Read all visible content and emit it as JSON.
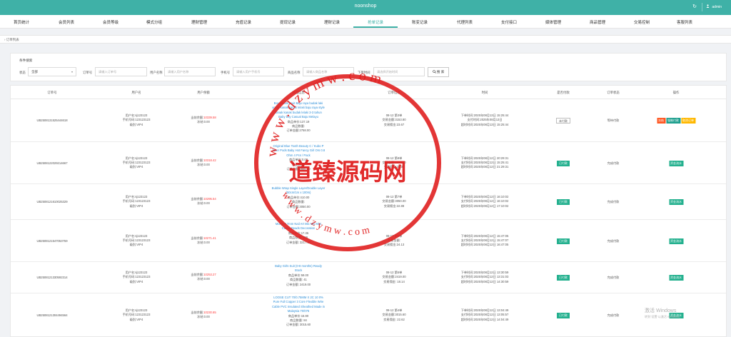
{
  "topbar": {
    "title": "noonshop",
    "refresh_icon": "↻",
    "user_icon": "person-icon",
    "username": "admin"
  },
  "nav": [
    "首页统计",
    "会员列表",
    "会员等级",
    "模式分组",
    "理财管理",
    "充值记录",
    "提现记录",
    "理财记录",
    "抢单记录",
    "账变记录",
    "代理列表",
    "支付接口",
    "媒体管理",
    "商品管理",
    "交易控制",
    "客服列表"
  ],
  "nav_active_index": 8,
  "breadcrumb": "订单列表",
  "filter": {
    "title": "条件搜索",
    "status_label": "状态",
    "status_value": "全部",
    "order_label": "订单号",
    "order_placeholder": "请输入订单号",
    "user_label": "用户名称",
    "user_placeholder": "请输入用户名称",
    "phone_label": "手机号",
    "phone_placeholder": "请输入用户手机号",
    "goods_label": "商品名称",
    "goods_placeholder": "请输入商品名称",
    "time_label": "下单时间",
    "time_placeholder": "请选择开始时间",
    "search_button": "搜 索"
  },
  "table": {
    "headers": [
      "订单号",
      "用户名",
      "用户余额",
      "商品信息",
      "订单信息",
      "时间",
      "是否付款",
      "订单状态",
      "操作"
    ],
    "rows": [
      {
        "order_id": "UB2508131525444618",
        "user": [
          "用户名:sj123123",
          "手机号码:123123123",
          "级别:VIP4"
        ],
        "balance_label": "当前余额:",
        "balance_value": "10339.58",
        "frozen": "冻结:0.00",
        "goods": "Boy fashion suit Baju raya budak laki untuk kanak kanak lelaki baju raya style kanak kanak budak lelaki 3-3 tahun Baby boy Casual Baju Melayu",
        "goods_price": "商品单价:137.19",
        "goods_qty": "商品数量:",
        "goods_total": "订单金额:2758.00",
        "order_info": [
          "08-12 第3单",
          "交易金额:3153.80",
          "交易佣金:23.67"
        ],
        "time": [
          "下单时间:2025年08月13日 15:25:44",
          "支付时间:2025年08月13日",
          "超时时间:2025年08月13日 15:25:44"
        ],
        "pay": "未付款",
        "pay_type": "wait",
        "status": "等待付款",
        "ops": [
          {
            "label": "冻结",
            "color": "red"
          },
          {
            "label": "强制付款",
            "color": "teal"
          },
          {
            "label": "取消订单",
            "color": "yellow"
          }
        ]
      },
      {
        "order_id": "UB2508122029214667",
        "user": [
          "用户名:sj123123",
          "手机号码:123123123",
          "级别:VIP4"
        ],
        "balance_label": "当前余额:",
        "balance_value": "10318.42",
        "frozen": "冻结:0.00",
        "goods": "Original Blue Tooth Beauty C / Kubo P Joker Pods Baby Hot Fancy Girl Ors 0.8 Ohm 4 Pcs / Pack",
        "goods_price": "商品单价:0.00",
        "goods_qty": "商品数量:",
        "goods_total": "订单金额:2850.00",
        "order_info": [
          "08-12 第8单",
          "交易金额:2850.00",
          "交易佣金:21.32"
        ],
        "time": [
          "下单时间:2025年08月12日 20:29:31",
          "支付时间:2025年08月12日 15:25:41",
          "超时时间:2025年08月12日 21:29:31"
        ],
        "pay": "已付款",
        "pay_type": "paid",
        "status": "完成付款",
        "ops": [
          {
            "label": "资金流水",
            "color": "green"
          }
        ]
      },
      {
        "order_id": "UB2508121610025329",
        "user": [
          "用户名:sj123123",
          "手机号码:123123123",
          "级别:VIP4"
        ],
        "balance_label": "当前余额:",
        "balance_value": "10295.54",
        "frozen": "冻结:0.00",
        "goods": "Bubble Wrap Single Layer/Double Layer (50cm/1m x 100m)",
        "goods_price": "商品单价:410.00",
        "goods_qty": "商品数量:",
        "goods_total": "订单金额:3050.00",
        "order_info": [
          "08-12 第7单",
          "交易金额:3050.00",
          "交易佣金:22.88"
        ],
        "time": [
          "下单时间:2025年08月12日 16:10:02",
          "支付时间:2025年08月12日 16:10:02",
          "超时时间:2025年08月12日 17:10:02"
        ],
        "pay": "已付款",
        "pay_type": "paid",
        "status": "完成付款",
        "ops": [
          {
            "label": "资金流水",
            "color": "green"
          }
        ]
      },
      {
        "order_id": "UB2508121547053759",
        "user": [
          "用户名:sj123123",
          "手机号码:123123123",
          "级别:VIP4"
        ],
        "balance_label": "当前余额:",
        "balance_value": "10271.41",
        "frozen": "冻结:0.00",
        "goods": "Manjo 0.7mm Nail Art Mix Mix Mini Caviar Beads Decoration",
        "goods_price": "商品单价:17.35",
        "goods_qty": "商品数量: 186",
        "goods_total": "订单金额: 3217.80",
        "order_info": [
          "08-12 第6单",
          "交易金额:",
          "交易佣金:24.13"
        ],
        "time": [
          "下单时间:2025年08月12日 15:47:05",
          "支付时间:2025年08月12日 15:47:07",
          "超时时间:2025年08月12日 16:47:05"
        ],
        "pay": "已付款",
        "pay_type": "paid",
        "status": "完成付款",
        "ops": [
          {
            "label": "资金流水",
            "color": "green"
          }
        ]
      },
      {
        "order_id": "UB2508121330592314",
        "user": [
          "用户名:sj123123",
          "手机号码:123123123",
          "级别:VIP4"
        ],
        "balance_label": "当前余额:",
        "balance_value": "10253.27",
        "frozen": "冻结:0.00",
        "goods": "Baby Girls Suit (0-8 months) Ready Stock",
        "goods_price": "商品单价:59.00",
        "goods_qty": "商品数量: 41",
        "goods_total": "订单金额: 2419.00",
        "order_info": [
          "08-12 第5单",
          "交易金额:2419.00",
          "交易佣金: 18.14"
        ],
        "time": [
          "下单时间:2025年08月12日 13:30:59",
          "支付时间:2025年08月12日 13:31:03",
          "超时时间:2025年08月12日 14:30:59"
        ],
        "pay": "已付款",
        "pay_type": "paid",
        "status": "完成付款",
        "ops": [
          {
            "label": "资金流水",
            "color": "green"
          }
        ]
      },
      {
        "order_id": "UB2508121304494564",
        "user": [
          "用户名:sj123123",
          "手机号码:123123123",
          "级别:VIP4"
        ],
        "balance_label": "当前余额:",
        "balance_value": "10230.65",
        "frozen": "冻结:0.00",
        "goods": "LOOSE CUT 70/0.75MM X 2C 10 0% Pure Full Copper 3 Core Flexible Wire Cable PVC Insulated Sheathed Made in Malaysia 70/076",
        "goods_price": "商品单价:15.90",
        "goods_qty": "商品数量: 84",
        "goods_total": "订单金额: 3015.60",
        "order_info": [
          "08-12 第4单",
          "交易金额:3015.60",
          "交易佣金: 22.62"
        ],
        "time": [
          "下单时间:2025年08月12日 13:04:49",
          "支付时间:2025年08月12日 13:05:57",
          "超时时间:2025年08月12日 14:04:49"
        ],
        "pay": "已付款",
        "pay_type": "paid",
        "status": "完成付款",
        "ops": [
          {
            "label": "资金流水",
            "color": "green"
          }
        ]
      }
    ]
  },
  "watermark": {
    "text_main": "道臻源码网",
    "text_top": "w w w . d z y m w . c o m",
    "text_bottom": "w w w . d z y m w . c o m",
    "color": "#e02020"
  },
  "windows_activation": {
    "line1": "激活 Windows",
    "line2": "转到\"设置\"以激活 Windows。"
  },
  "colors": {
    "accent": "#3fb1a7",
    "red": "#ff3b3b",
    "link": "#2e8fd8",
    "paid": "#23b08e"
  }
}
